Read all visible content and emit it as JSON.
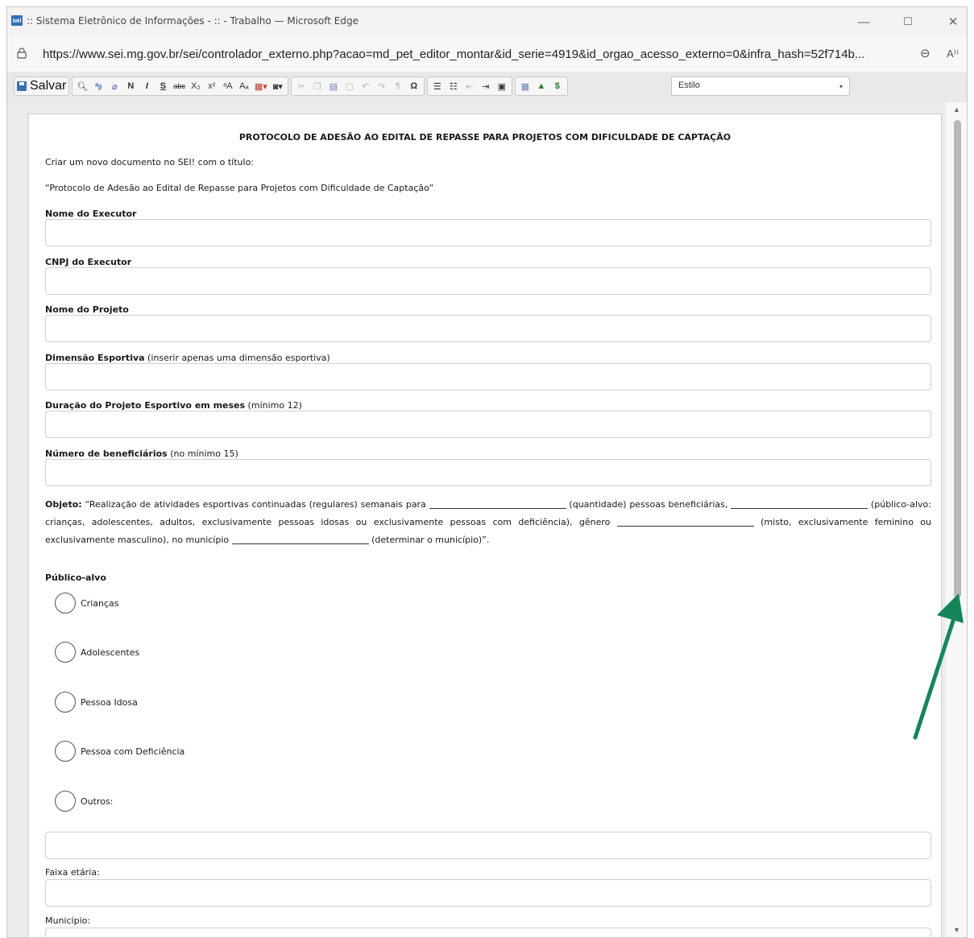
{
  "window": {
    "title": ":: Sistema Eletrônico de Informações - :: - Trabalho — Microsoft Edge",
    "app_icon_text": "sei",
    "minimize": "—",
    "maximize": "☐",
    "close": "✕"
  },
  "address_bar": {
    "url": "https://www.sei.mg.gov.br/sei/controlador_externo.php?acao=md_pet_editor_montar&id_serie=4919&id_orgao_acesso_externo=0&infra_hash=52f714b...",
    "zoom_icon": "⊖",
    "read_aloud_icon": "A⁾⁾"
  },
  "toolbar": {
    "save_label": "Salvar",
    "bold": "N",
    "italic": "I",
    "underline": "S",
    "strike": "abc",
    "subscript": "X₂",
    "superscript": "x²",
    "style_label": "Estilo",
    "style_caret": "▾"
  },
  "document": {
    "title": "PROTOCOLO DE ADESÃO AO EDITAL DE REPASSE PARA PROJETOS COM DIFICULDADE DE CAPTAÇÃO",
    "intro": "Criar um novo documento no SEI! com o título:",
    "quote_title": "“Protocolo de Adesão ao Edital de Repasse para Projetos com Dificuldade de Captação”",
    "fields": [
      {
        "label": "Nome do Executor",
        "hint": ""
      },
      {
        "label": "CNPJ do Executor",
        "hint": ""
      },
      {
        "label": "Nome do Projeto",
        "hint": ""
      },
      {
        "label": "Dimensão Esportiva",
        "hint": " (inserir apenas uma dimensão esportiva)"
      },
      {
        "label": "Duração do Projeto Esportivo em meses",
        "hint": " (mínimo 12)"
      },
      {
        "label": "Número de beneficiários",
        "hint": " (no mínimo 15)"
      }
    ],
    "objeto": {
      "label": "Objeto:",
      "part1": " “Realização de atividades esportivas continuadas (regulares) semanais para ",
      "part2": " (quantidade) pessoas beneficiárias, ",
      "part3": " (público-alvo: crianças, adolescentes, adultos, exclusivamente pessoas idosas ou exclusivamente pessoas com deficiência), gênero ",
      "part4": " (misto, exclusivamente feminino ou exclusivamente masculino), no município ",
      "part5": " (determinar o município)”."
    },
    "publico_alvo": {
      "label": "Público-alvo",
      "options": [
        "Crianças",
        "Adolescentes",
        "Pessoa Idosa",
        "Pessoa com Deficiência",
        "Outros:"
      ]
    },
    "faixa_etaria": "Faixa etária:",
    "municipio": "Município:"
  },
  "scrollbar": {
    "up": "▲",
    "down": "▼"
  },
  "colors": {
    "arrow": "#17855a",
    "save_icon": "#3d6fb0"
  }
}
